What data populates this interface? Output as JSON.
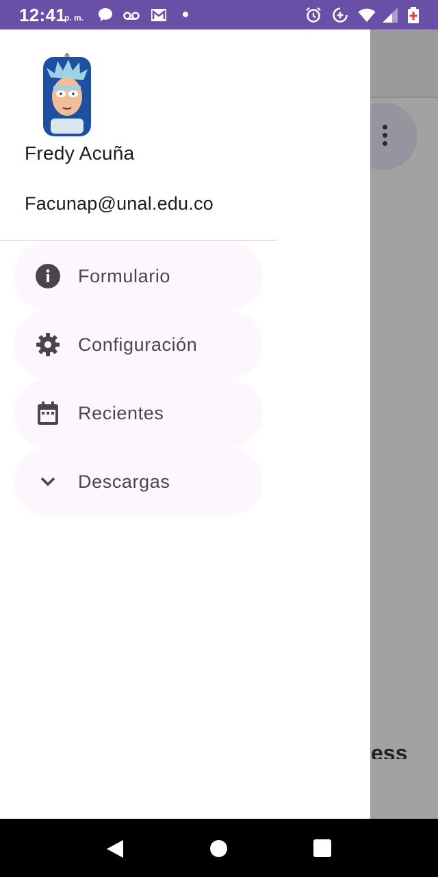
{
  "status_bar": {
    "time": "12:41",
    "ampm": "p. m.",
    "left_icons": [
      "chat-bubble-icon",
      "voicemail-icon",
      "gmail-icon",
      "notification-dot-icon"
    ],
    "right_icons": [
      "alarm-icon",
      "data-saver-icon",
      "wifi-icon",
      "signal-icon",
      "battery-icon"
    ],
    "background_color": "#6a4fa7"
  },
  "drawer": {
    "header": {
      "avatar": "rick-avatar-image",
      "name": "Fredy Acuña",
      "email": "Facunap@unal.edu.co"
    },
    "items": [
      {
        "label": "Formulario",
        "icon": "info-icon"
      },
      {
        "label": "Configuración",
        "icon": "settings-gear-icon"
      },
      {
        "label": "Recientes",
        "icon": "calendar-icon"
      },
      {
        "label": "Descargas",
        "icon": "chevron-down-icon"
      }
    ],
    "item_background": "#fdf6fd",
    "text_color": "#49454f"
  },
  "background_app": {
    "partial_text": "ess",
    "overflow_menu_icon": "more-vert-icon"
  },
  "nav_bar": {
    "buttons": [
      "back-icon",
      "home-icon",
      "recents-icon"
    ]
  }
}
